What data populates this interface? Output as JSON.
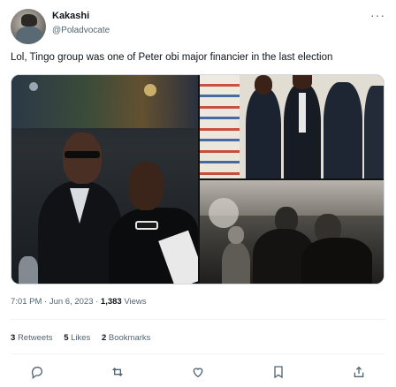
{
  "author": {
    "name": "Kakashi",
    "handle": "@Poladvocate"
  },
  "more_icon": "more-horizontal-icon",
  "tweet_text": "Lol, Tingo group was one of Peter obi major financier in the last election",
  "meta": {
    "time": "7:01 PM · Jun 6, 2023 · ",
    "views_count": "1,383",
    "views_label": " Views"
  },
  "stats": {
    "retweets_count": "3",
    "retweets_label": "Retweets",
    "likes_count": "5",
    "likes_label": "Likes",
    "bookmarks_count": "2",
    "bookmarks_label": "Bookmarks"
  },
  "actions": [
    "reply-icon",
    "retweet-icon",
    "like-icon",
    "bookmark-icon",
    "share-icon"
  ],
  "colors": {
    "text_primary": "#0f1419",
    "text_secondary": "#536471",
    "divider": "#eff3f4"
  }
}
